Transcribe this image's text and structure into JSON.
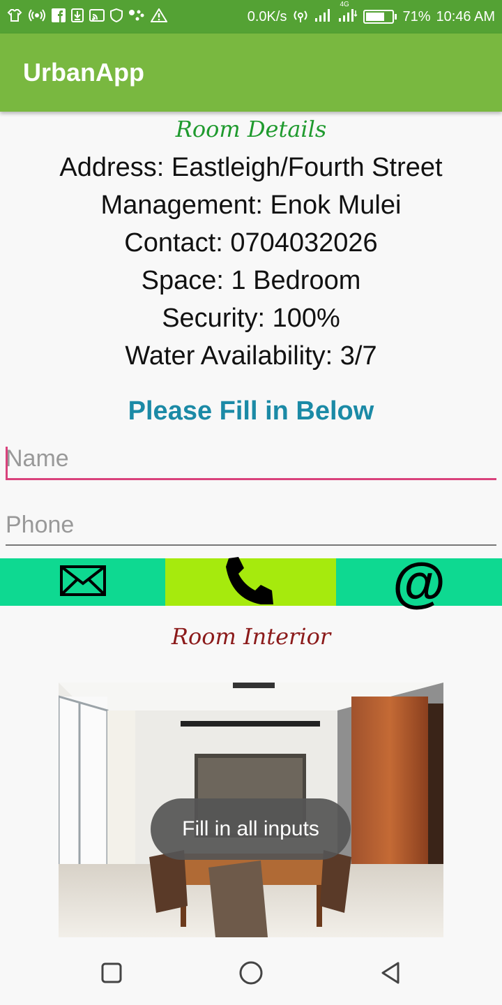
{
  "status_bar": {
    "network_speed": "0.0K/s",
    "network_type": "4G",
    "battery_percent": "71%",
    "battery_level": 0.71,
    "time": "10:46 AM",
    "icons": [
      "shirt-icon",
      "hotspot-icon",
      "facebook-icon",
      "download-icon",
      "cast-icon",
      "shield-icon",
      "dots-icon",
      "warning-icon",
      "wifi-icon",
      "signal-icon",
      "battery-icon"
    ]
  },
  "app_bar": {
    "title": "UrbanApp"
  },
  "room_details": {
    "heading": "Room Details",
    "lines": [
      "Address: Eastleigh/Fourth Street",
      "Management: Enok Mulei",
      "Contact: 0704032026",
      "Space:  1 Bedroom",
      "Security:  100%",
      "Water Availability:  3/7"
    ]
  },
  "form": {
    "heading": "Please Fill in Below",
    "name_placeholder": "Name",
    "name_value": "",
    "phone_placeholder": "Phone",
    "phone_value": ""
  },
  "actions": {
    "email_icon": "envelope-icon",
    "call_icon": "phone-icon",
    "web_symbol": "@"
  },
  "room_interior": {
    "heading": "Room Interior"
  },
  "toast": {
    "message": "Fill in all inputs"
  },
  "colors": {
    "status_bar": "#54a234",
    "app_bar": "#79b840",
    "details_heading": "#1f9a2e",
    "interior_heading": "#8b1a1a",
    "fill_heading": "#1b8aa6",
    "name_underline": "#d9427c",
    "action_green": "#0ed991",
    "action_lime": "#a6ea0d"
  }
}
